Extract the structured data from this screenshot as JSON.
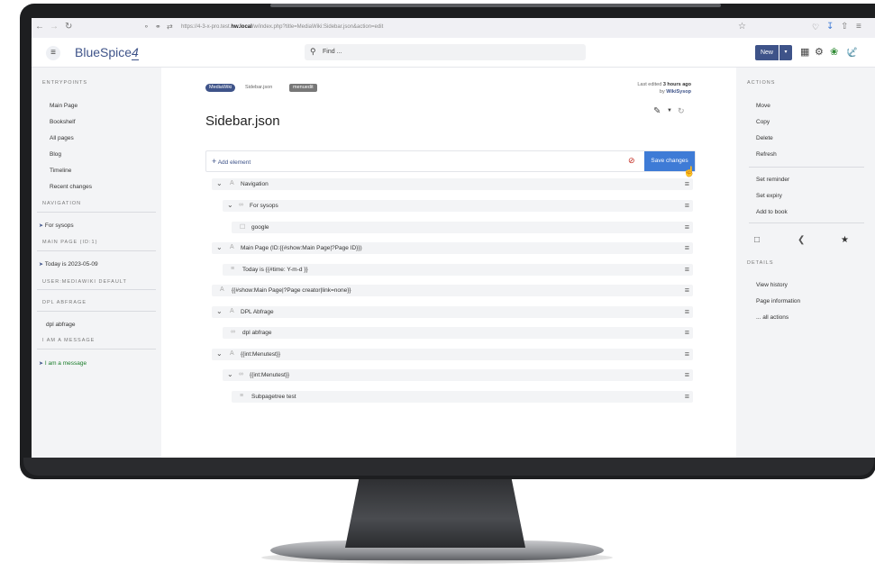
{
  "browser": {
    "url_prefix": "https://4-3-x-pro.test.",
    "url_host": "hw.local",
    "url_path": "/w/index.php?title=MediaWiki:Sidebar.json&action=edit"
  },
  "header": {
    "logo": "BlueSpice",
    "logo_mark": "4",
    "search_placeholder": "Find ...",
    "new_label": "New"
  },
  "left_sidebar": {
    "entrypoints_heading": "ENTRYPOINTS",
    "entrypoints": [
      "Main Page",
      "Bookshelf",
      "All pages",
      "Blog",
      "Timeline",
      "Recent changes"
    ],
    "navigation_heading": "NAVIGATION",
    "navigation_item": "For sysops",
    "main_page_heading": "MAIN PAGE (ID:1)",
    "main_page_item": "Today is 2023-05-09",
    "mediawiki_heading": "USER:MEDIAWIKI DEFAULT",
    "dpl_heading": "DPL ABFRAGE",
    "dpl_item": "dpl abfrage",
    "message_heading": "I AM A MESSAGE",
    "message_item": "I am a message"
  },
  "main": {
    "badge_ns": "MediaWiki",
    "breadcrumb_page": "Sidebar.json",
    "badge_tag": "menuedit",
    "last_edited_prefix": "Last edited",
    "last_edited_time": "3 hours ago",
    "by_prefix": "by",
    "by_user": "WikiSysop",
    "page_title": "Sidebar.json",
    "add_element_label": "Add element",
    "save_label": "Save changes",
    "tree": [
      {
        "text": "Navigation",
        "expanded": true,
        "icon": "text-icon"
      },
      {
        "text": "For sysops",
        "expanded": true,
        "icon": "link-icon"
      },
      {
        "text": "google",
        "expanded": false,
        "icon": "external-link-icon"
      },
      {
        "text": "Main Page (ID:{{#show:Main Page|?Page ID}})",
        "expanded": true,
        "icon": "text-icon"
      },
      {
        "text": "Today is {{#time: Y-m-d }}",
        "expanded": false,
        "icon": "list-icon"
      },
      {
        "text": "{{#show:Main Page|?Page creator|link=none}}",
        "expanded": false,
        "icon": "text-icon"
      },
      {
        "text": "DPL Abfrage",
        "expanded": true,
        "icon": "text-icon"
      },
      {
        "text": "dpl abfrage",
        "expanded": false,
        "icon": "link-icon"
      },
      {
        "text": "{{int:Menutest}}",
        "expanded": true,
        "icon": "text-icon"
      },
      {
        "text": "{{int:Menutest}}",
        "expanded": true,
        "icon": "link-icon"
      },
      {
        "text": "Subpagetree test",
        "expanded": false,
        "icon": "list-icon"
      }
    ]
  },
  "right_sidebar": {
    "actions_heading": "ACTIONS",
    "actions": [
      "Move",
      "Copy",
      "Delete",
      "Refresh"
    ],
    "actions2": [
      "Set reminder",
      "Set expiry",
      "Add to book"
    ],
    "details_heading": "DETAILS",
    "details": [
      "View history",
      "Page information",
      "... all actions"
    ]
  },
  "colors": {
    "brand": "#3e5389",
    "save_button": "#3e7bd6",
    "cancel": "#c2271c",
    "message_green": "#1a7d2a"
  }
}
